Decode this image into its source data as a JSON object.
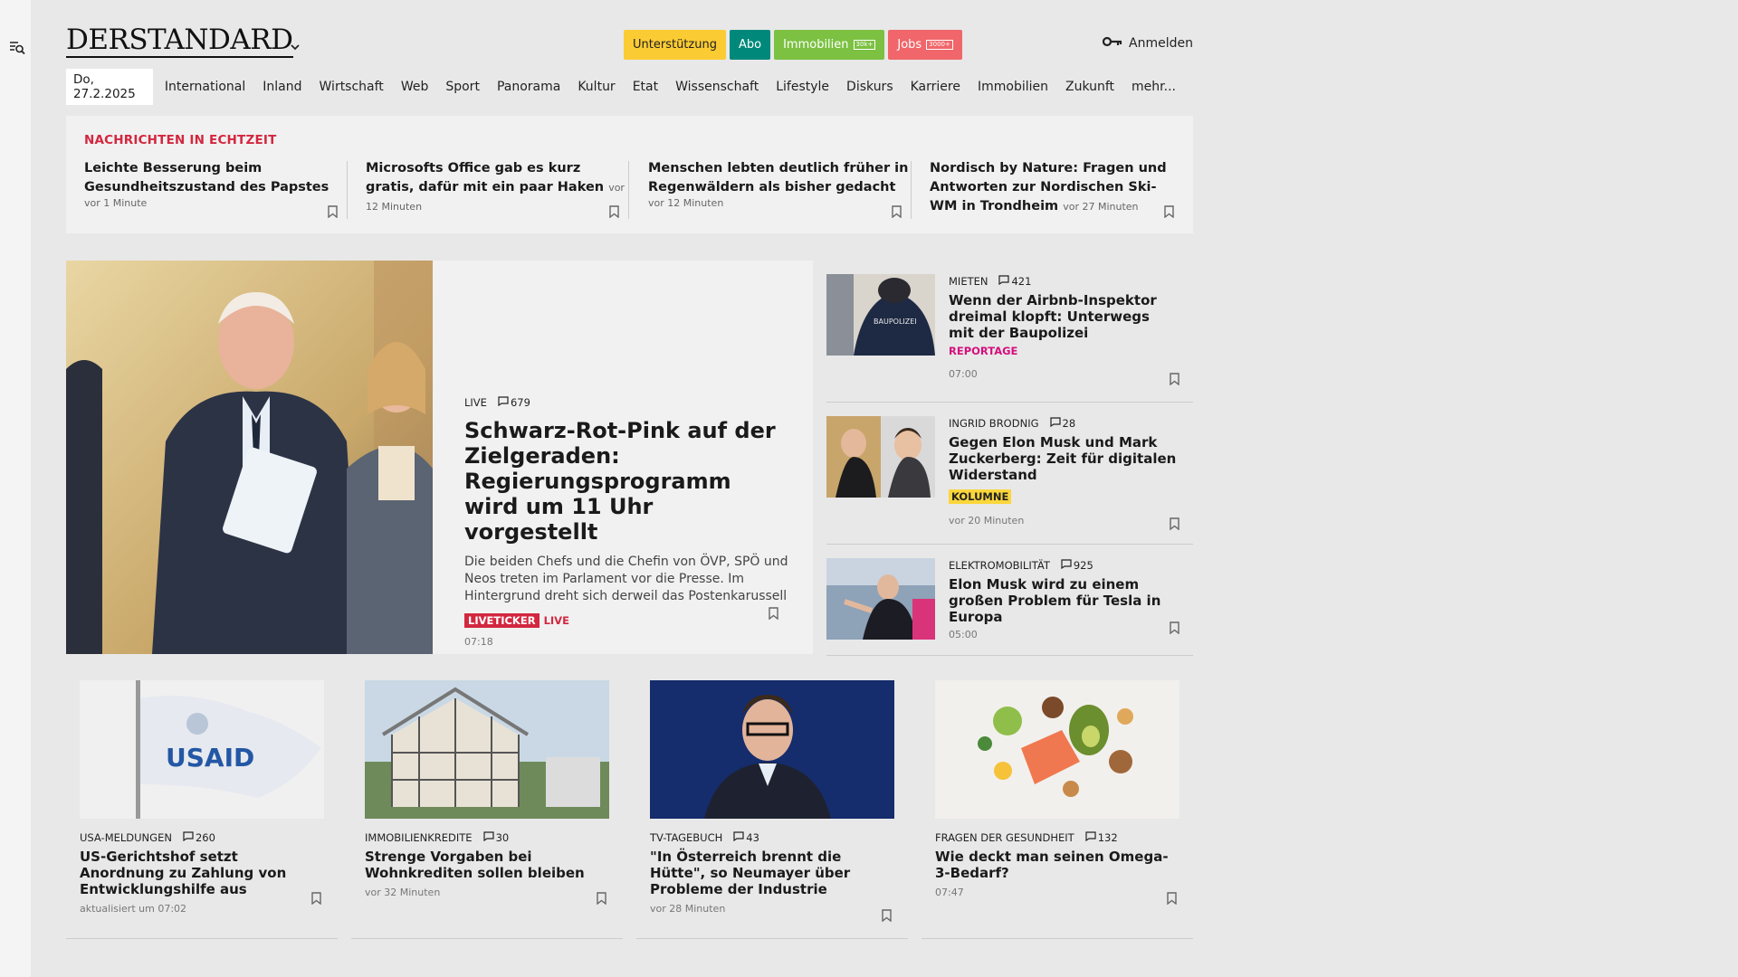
{
  "header": {
    "logo": "DERSTANDARD",
    "pills": [
      {
        "label": "Unterstützung",
        "tag": ""
      },
      {
        "label": "Abo",
        "tag": ""
      },
      {
        "label": "Immobilien",
        "tag": "30k+"
      },
      {
        "label": "Jobs",
        "tag": "3000+"
      }
    ],
    "login": "Anmelden"
  },
  "nav": {
    "date": "Do, 27.2.2025",
    "items": [
      "International",
      "Inland",
      "Wirtschaft",
      "Web",
      "Sport",
      "Panorama",
      "Kultur",
      "Etat",
      "Wissenschaft",
      "Lifestyle",
      "Diskurs",
      "Karriere",
      "Immobilien",
      "Zukunft",
      "mehr..."
    ]
  },
  "ticker": {
    "title": "NACHRICHTEN IN ECHTZEIT",
    "items": [
      {
        "title": "Leichte Besserung beim Gesundheitszustand des Papstes",
        "time": "vor 1 Minute"
      },
      {
        "title": "Microsofts Office gab es kurz gratis, dafür mit ein paar Haken",
        "time": "vor 12 Minuten"
      },
      {
        "title": "Menschen lebten deutlich früher in Regenwäldern als bisher gedacht",
        "time": "vor 12 Minuten"
      },
      {
        "title": "Nordisch by Nature: Fragen und Antworten zur Nordischen Ski-WM in Trondheim",
        "time": "vor 27 Minuten"
      }
    ]
  },
  "feature": {
    "kicker": "LIVE",
    "comments": "679",
    "title": "Schwarz-Rot-Pink auf der Zielgeraden: Regierungsprogramm wird um 11 Uhr vorgestellt",
    "teaser": "Die beiden Chefs und die Chefin von ÖVP, SPÖ und Neos treten im Parlament vor die Presse. Im Hintergrund dreht sich derweil das Postenkarussell",
    "badge": "LIVETICKER",
    "badge2": "LIVE",
    "time": "07:18"
  },
  "side": [
    {
      "kicker": "MIETEN",
      "comments": "421",
      "title": "Wenn der Airbnb-Inspektor dreimal klopft: Unterwegs mit der Baupolizei",
      "tag": "REPORTAGE",
      "time": "07:00"
    },
    {
      "kicker": "INGRID BRODNIG",
      "comments": "28",
      "title": "Gegen Elon Musk und Mark Zuckerberg: Zeit für digitalen Widerstand",
      "tag": "KOLUMNE",
      "time": "vor 20 Minuten"
    },
    {
      "kicker": "ELEKTROMOBILITÄT",
      "comments": "925",
      "title": "Elon Musk wird zu einem großen Problem für Tesla in Europa",
      "tag": "",
      "time": "05:00"
    }
  ],
  "cards": [
    {
      "kicker": "USA-MELDUNGEN",
      "comments": "260",
      "title": "US-Gerichtshof setzt Anordnung zu Zahlung von Entwicklungshilfe aus",
      "time": "aktualisiert um 07:02",
      "img_text": "USAID"
    },
    {
      "kicker": "IMMOBILIENKREDITE",
      "comments": "30",
      "title": "Strenge Vorgaben bei Wohnkrediten sollen bleiben",
      "time": "vor 32 Minuten"
    },
    {
      "kicker": "TV-TAGEBUCH",
      "comments": "43",
      "title": "\"In Österreich brennt die Hütte\", so Neumayer über Probleme der Industrie",
      "time": "vor 28 Minuten"
    },
    {
      "kicker": "FRAGEN DER GESUNDHEIT",
      "comments": "132",
      "title": "Wie deckt man seinen Omega-3-Bedarf?",
      "time": "07:47"
    }
  ]
}
